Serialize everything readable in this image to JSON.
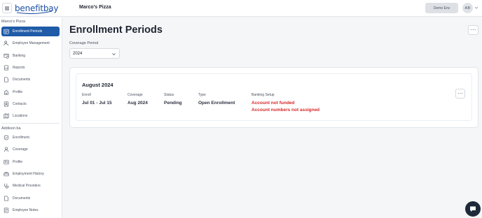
{
  "header": {
    "menu_icon": "hamburger-icon",
    "logo_text": "benefitbay",
    "company": "Marco's Pizza",
    "env_label": "Demo Env",
    "avatar_initials": "AB",
    "colors": {
      "brand": "#1c4fa6",
      "accent": "#1f5ba8"
    }
  },
  "sidebar": {
    "section_company": "Marco's Pizza",
    "company_items": [
      {
        "label": "Enrollment Periods",
        "icon": "calendar-list-icon",
        "active": true
      },
      {
        "label": "Employee Management",
        "icon": "user-manage-icon"
      },
      {
        "label": "Banking",
        "icon": "bank-icon"
      },
      {
        "label": "Reports",
        "icon": "report-icon"
      },
      {
        "label": "Documents",
        "icon": "document-icon"
      },
      {
        "label": "Profile",
        "icon": "building-icon"
      },
      {
        "label": "Contacts",
        "icon": "contacts-icon"
      },
      {
        "label": "Locations",
        "icon": "map-icon"
      }
    ],
    "section_user": "Addison ba",
    "user_items": [
      {
        "label": "Enrollment",
        "icon": "shield-check-icon"
      },
      {
        "label": "Coverage",
        "icon": "user-icon"
      },
      {
        "label": "Profile",
        "icon": "profile-card-icon"
      },
      {
        "label": "Employment History",
        "icon": "briefcase-icon"
      },
      {
        "label": "Medical Providers",
        "icon": "stethoscope-icon"
      },
      {
        "label": "Documents",
        "icon": "document-icon"
      },
      {
        "label": "Employee Notes",
        "icon": "notes-icon"
      }
    ]
  },
  "main": {
    "title": "Enrollment Periods",
    "coverage_period_label": "Coverage Period",
    "coverage_period_value": "2024",
    "period": {
      "title": "August 2024",
      "columns": [
        {
          "label": "Enroll",
          "value": "Jul 01 - Jul 15"
        },
        {
          "label": "Coverage",
          "value": "Aug 2024"
        },
        {
          "label": "Status",
          "value": "Pending"
        },
        {
          "label": "Type",
          "value": "Open Enrollment"
        }
      ],
      "banking_label": "Banking Setup",
      "banking_alerts": [
        "Account not funded",
        "Account numbers not assigned"
      ],
      "alert_color": "#d62828"
    }
  },
  "chat_icon": "chat-bubble-icon"
}
